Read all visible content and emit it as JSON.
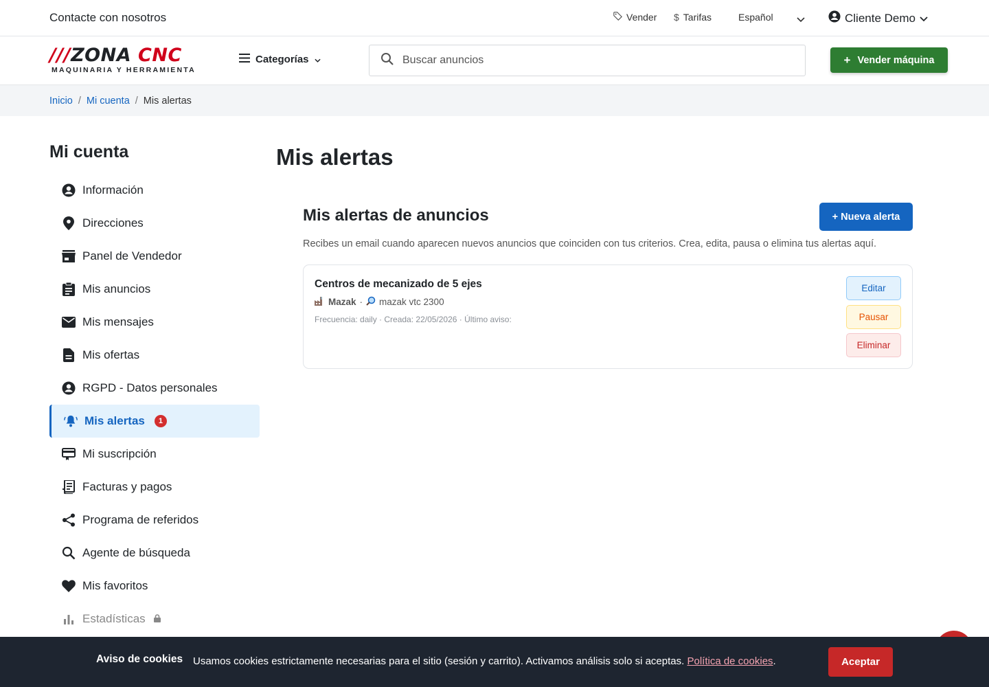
{
  "topbar": {
    "contact": "Contacte con nosotros",
    "sell": "Vender",
    "pricing": "Tarifas",
    "language": "Español",
    "user": "Cliente Demo"
  },
  "header": {
    "logo_main_prefix": "///",
    "logo_main_a": "ZONA",
    "logo_main_b": "CNC",
    "logo_sub": "MAQUINARIA Y HERRAMIENTA",
    "categories": "Categorías",
    "search_placeholder": "Buscar anuncios",
    "sell_button": "Vender máquina"
  },
  "breadcrumb": {
    "home": "Inicio",
    "account": "Mi cuenta",
    "current": "Mis alertas",
    "sep": "/"
  },
  "sidebar": {
    "title": "Mi cuenta",
    "items": [
      {
        "label": "Información",
        "icon": "user-circle-icon"
      },
      {
        "label": "Direcciones",
        "icon": "location-pin-icon"
      },
      {
        "label": "Panel de Vendedor",
        "icon": "store-icon"
      },
      {
        "label": "Mis anuncios",
        "icon": "clipboard-icon"
      },
      {
        "label": "Mis mensajes",
        "icon": "envelope-icon"
      },
      {
        "label": "Mis ofertas",
        "icon": "document-icon"
      },
      {
        "label": "RGPD - Datos personales",
        "icon": "user-circle-icon"
      },
      {
        "label": "Mis alertas",
        "icon": "bell-icon",
        "badge": "1",
        "active": true
      },
      {
        "label": "Mi suscripción",
        "icon": "card-icon"
      },
      {
        "label": "Facturas y pagos",
        "icon": "receipt-icon"
      },
      {
        "label": "Programa de referidos",
        "icon": "share-icon"
      },
      {
        "label": "Agente de búsqueda",
        "icon": "search-icon"
      },
      {
        "label": "Mis favoritos",
        "icon": "heart-icon"
      },
      {
        "label": "Estadísticas",
        "icon": "bar-chart-icon",
        "locked": true
      }
    ]
  },
  "main": {
    "title": "Mis alertas",
    "section_title": "Mis alertas de anuncios",
    "new_alert": "+ Nueva alerta",
    "description": "Recibes un email cuando aparecen nuevos anuncios que coinciden con tus criterios. Crea, edita, pausa o elimina tus alertas aquí."
  },
  "alerts": [
    {
      "name": "Centros de mecanizado de 5 ejes",
      "brand": "Mazak",
      "dot": "·",
      "keywords": "mazak vtc 2300",
      "meta": "Frecuencia: daily · Creada: 22/05/2026 · Último aviso:",
      "edit": "Editar",
      "pause": "Pausar",
      "delete": "Eliminar"
    }
  ],
  "cookie": {
    "title": "Aviso de cookies",
    "text": "Usamos cookies estrictamente necesarias para el sitio (sesión y carrito). Activamos análisis solo si aceptas.",
    "link": "Política de cookies",
    "period": ".",
    "accept": "Aceptar"
  },
  "colors": {
    "primary": "#1565c0",
    "success": "#2e7d32",
    "danger": "#c62828",
    "brand_red": "#d0021b"
  }
}
